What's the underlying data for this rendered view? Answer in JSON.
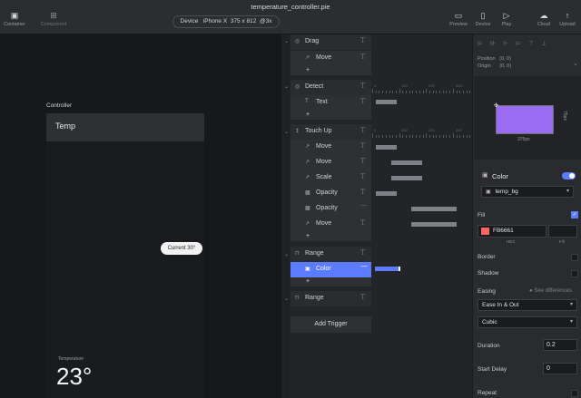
{
  "app": {
    "title": "temperature_controller.pie",
    "device_label": "Device",
    "device_name": "iPhone X",
    "device_size": "375 x 812",
    "device_scale": "@3x"
  },
  "toolbar": {
    "left": [
      {
        "label": "Container",
        "icon": "container-icon"
      },
      {
        "label": "Component",
        "icon": "component-icon"
      }
    ],
    "right": [
      {
        "label": "Preview",
        "icon": "preview-icon"
      },
      {
        "label": "Device",
        "icon": "device-icon"
      },
      {
        "label": "Play",
        "icon": "play-icon"
      },
      {
        "label": "Cloud",
        "icon": "cloud-icon"
      },
      {
        "label": "Upload",
        "icon": "upload-icon"
      }
    ]
  },
  "canvas": {
    "controller_label": "Controller",
    "temp_bar_text": "Temp",
    "tooltip_text": "Current 30°",
    "temperature_label": "Temperature",
    "temperature_value": "23°"
  },
  "timeline": {
    "groups": [
      {
        "name": "Drag",
        "children": [
          "Move"
        ]
      },
      {
        "name": "Detect",
        "children": [
          "Text"
        ]
      },
      {
        "name": "Touch Up",
        "children": [
          "Move",
          "Move",
          "Scale",
          "Opacity",
          "Opacity",
          "Move"
        ]
      },
      {
        "name": "Range",
        "children": [
          "Color"
        ],
        "selected_child": "Color"
      },
      {
        "name": "Range",
        "children": []
      }
    ],
    "add_symbol": "+",
    "add_trigger_label": "Add Trigger",
    "ruler_ticks": [
      "0",
      "100",
      "200",
      "300"
    ]
  },
  "inspector": {
    "position_label": "Position",
    "position_value": "(0, 0)",
    "origin_label": "Origin",
    "origin_value": "(0, 0)",
    "preview_width": "375px",
    "preview_height": "75px",
    "preview_color": "#9b6cf2",
    "color_label": "Color",
    "color_toggle_on": true,
    "layer_name": "temp_bg",
    "fill_label": "Fill",
    "fill_hex": "FB6661",
    "fill_color": "#fb6661",
    "hex_label": "HEX",
    "fill_alpha_label": "Fill",
    "border_label": "Border",
    "shadow_label": "Shadow",
    "easing_label": "Easing",
    "see_differences": "See differences",
    "easing_value": "Ease In & Out",
    "curve_value": "Cubic",
    "duration_label": "Duration",
    "duration_value": "0.2",
    "start_delay_label": "Start Delay",
    "start_delay_value": "0",
    "repeat_label": "Repeat"
  },
  "colors": {
    "accent": "#5b7cff",
    "panel_bg": "#2a2b2f",
    "canvas_bg": "#17181b"
  }
}
